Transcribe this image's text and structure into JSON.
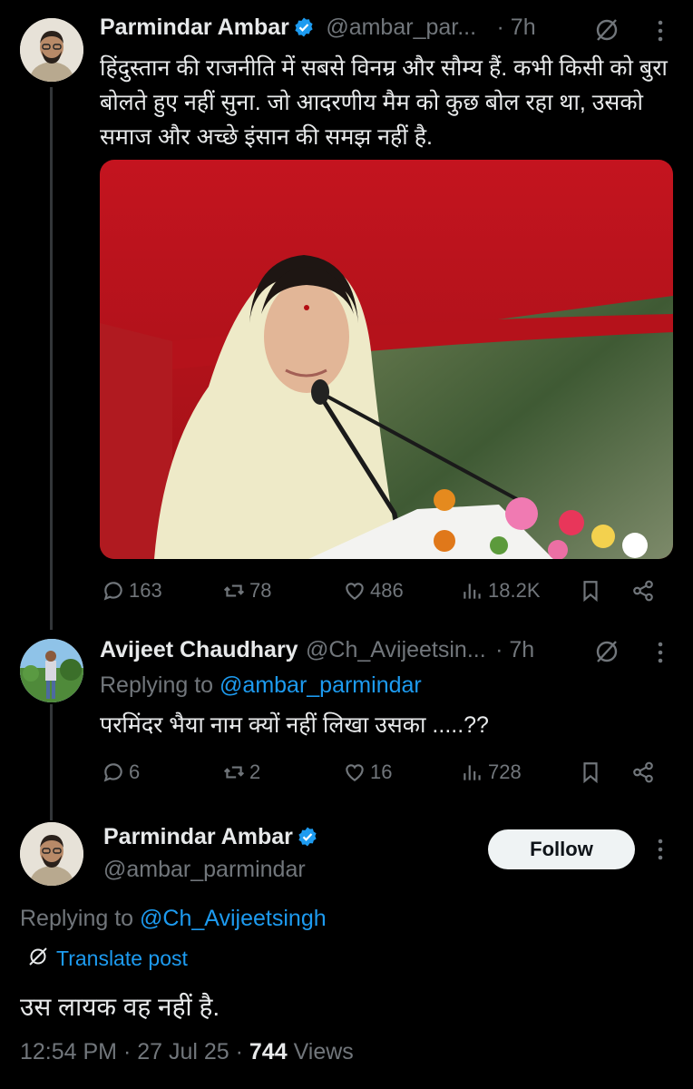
{
  "tweet1": {
    "name": "Parmindar Ambar",
    "handle": "@ambar_par...",
    "time": "· 7h",
    "text": "हिंदुस्तान की राजनीति में सबसे विनम्र और सौम्य हैं. कभी किसी को बुरा बोलते हुए नहीं सुना. जो आदरणीय मैम को कुछ बोल रहा था, उसको समाज और अच्छे इंसान की समझ नहीं है.",
    "stats": {
      "replies": "163",
      "reposts": "78",
      "likes": "486",
      "views": "18.2K"
    }
  },
  "tweet2": {
    "name": "Avijeet Chaudhary",
    "handle": "@Ch_Avijeetsin...",
    "time": "· 7h",
    "replying_prefix": "Replying to",
    "replying_handle": "@ambar_parmindar",
    "text": "परमिंदर भैया नाम क्यों नहीं लिखा उसका .....??",
    "stats": {
      "replies": "6",
      "reposts": "2",
      "likes": "16",
      "views": "728"
    }
  },
  "main": {
    "name": "Parmindar Ambar",
    "handle": "@ambar_parmindar",
    "follow_label": "Follow",
    "replying_prefix": "Replying to",
    "replying_handle": "@Ch_Avijeetsingh",
    "translate_label": "Translate post",
    "text": "उस लायक वह नहीं है.",
    "time": "12:54 PM · 27 Jul 25 · ",
    "views_count": "744",
    "views_label": " Views"
  },
  "colors": {
    "accent": "#1d9bf0",
    "muted": "#71767b",
    "background": "#000000"
  }
}
